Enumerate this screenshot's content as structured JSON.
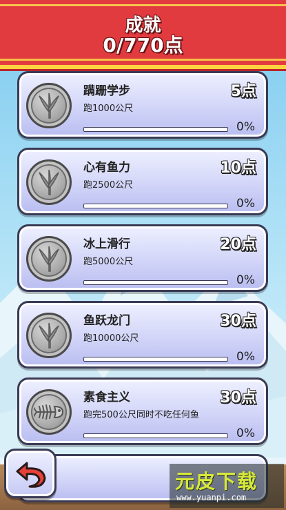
{
  "header": {
    "title": "成就",
    "points": "0/770点"
  },
  "achievements": [
    {
      "title": "蹒跚学步",
      "desc": "跑1000公尺",
      "points": "5点",
      "progress": 0,
      "percent": "0%",
      "icon": "bird-footprint-icon"
    },
    {
      "title": "心有鱼力",
      "desc": "跑2500公尺",
      "points": "10点",
      "progress": 0,
      "percent": "0%",
      "icon": "bird-footprint-icon"
    },
    {
      "title": "冰上滑行",
      "desc": "跑5000公尺",
      "points": "20点",
      "progress": 0,
      "percent": "0%",
      "icon": "bird-footprint-icon"
    },
    {
      "title": "鱼跃龙门",
      "desc": "跑10000公尺",
      "points": "30点",
      "progress": 0,
      "percent": "0%",
      "icon": "bird-footprint-icon"
    },
    {
      "title": "素食主义",
      "desc": "跑完500公尺同时不吃任何鱼",
      "points": "30点",
      "progress": 0,
      "percent": "0%",
      "icon": "fish-skeleton-icon"
    }
  ],
  "back_button": {
    "icon": "back-arrow-icon"
  },
  "watermark": {
    "main": "元皮下载",
    "url": "www.yuanpi.com"
  },
  "colors": {
    "header_red": "#e23b3f",
    "header_stripe": "#ffd23f",
    "card_bg": "#cfd2f7",
    "medal_silver": "#a9a9a9",
    "sky": "#a8def5",
    "back_arrow": "#e8413a"
  }
}
